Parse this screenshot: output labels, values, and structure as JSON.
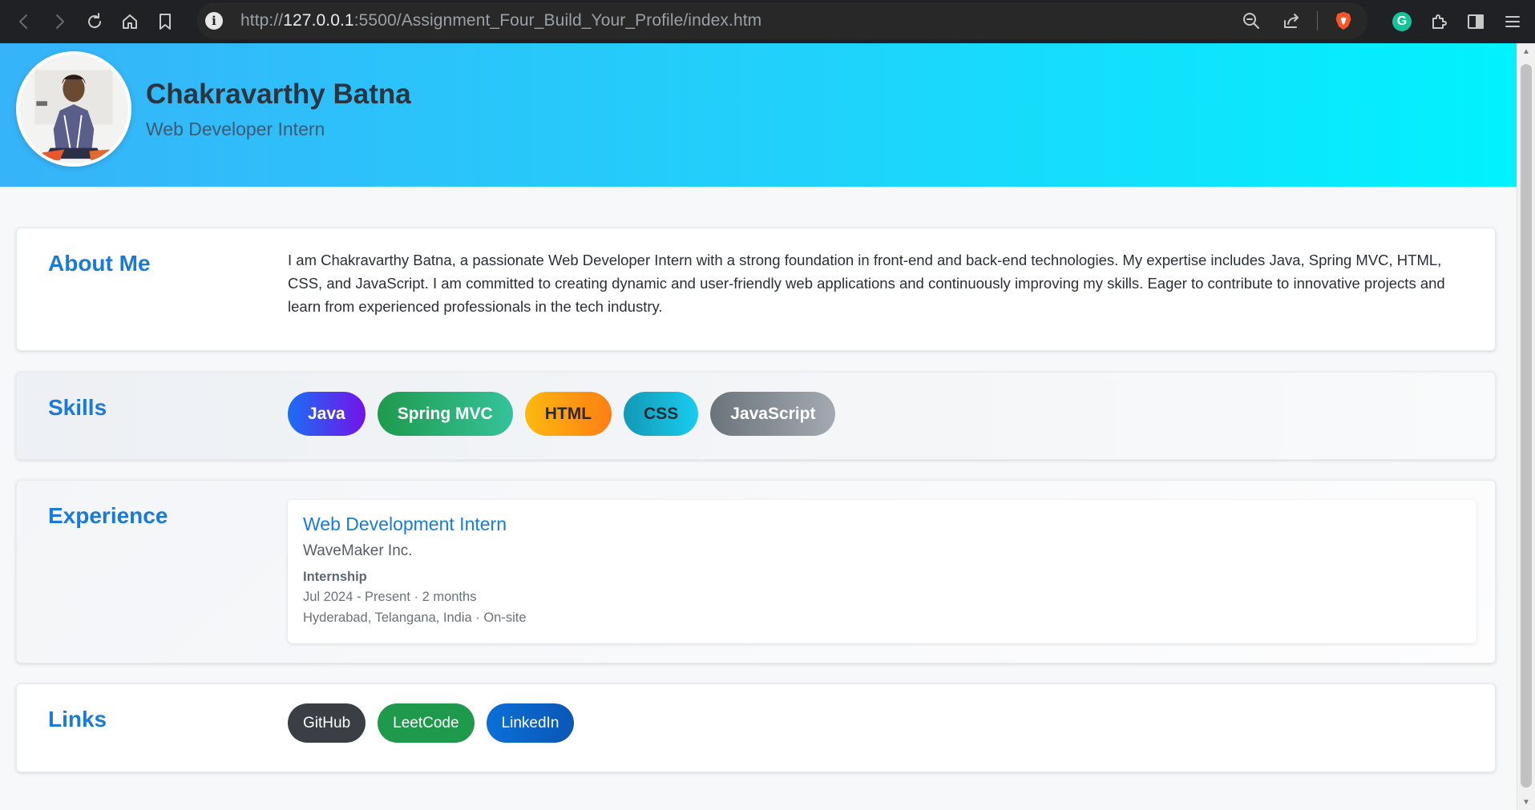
{
  "browser": {
    "url_prefix": "http://",
    "url_host": "127.0.0.1",
    "url_rest": ":5500/Assignment_Four_Build_Your_Profile/index.htm",
    "icons": [
      "back-icon",
      "forward-icon",
      "reload-icon",
      "home-icon",
      "bookmark-icon",
      "site-info-icon",
      "zoom-out-icon",
      "share-icon",
      "brave-shield-icon",
      "grammarly-icon",
      "extensions-icon",
      "sidebar-icon",
      "menu-icon"
    ]
  },
  "profile": {
    "name": "Chakravarthy Batna",
    "title": "Web Developer Intern"
  },
  "about": {
    "heading": "About Me",
    "text": "I am Chakravarthy Batna, a passionate Web Developer Intern with a strong foundation in front-end and back-end technologies. My expertise includes Java, Spring MVC, HTML, CSS, and JavaScript. I am committed to creating dynamic and user-friendly web applications and continuously improving my skills. Eager to contribute to innovative projects and learn from experienced professionals in the tech industry."
  },
  "skills": {
    "heading": "Skills",
    "items": [
      "Java",
      "Spring MVC",
      "HTML",
      "CSS",
      "JavaScript"
    ]
  },
  "experience": {
    "heading": "Experience",
    "role": "Web Development Intern",
    "company": "WaveMaker Inc.",
    "type": "Internship",
    "dates": "Jul 2024 - Present · 2 months",
    "location": "Hyderabad, Telangana, India · On-site"
  },
  "links": {
    "heading": "Links",
    "items": [
      "GitHub",
      "LeetCode",
      "LinkedIn"
    ]
  },
  "colors": {
    "header_start": "#37b3f9",
    "header_end": "#00f2fe",
    "accent": "#1a7ad9"
  }
}
